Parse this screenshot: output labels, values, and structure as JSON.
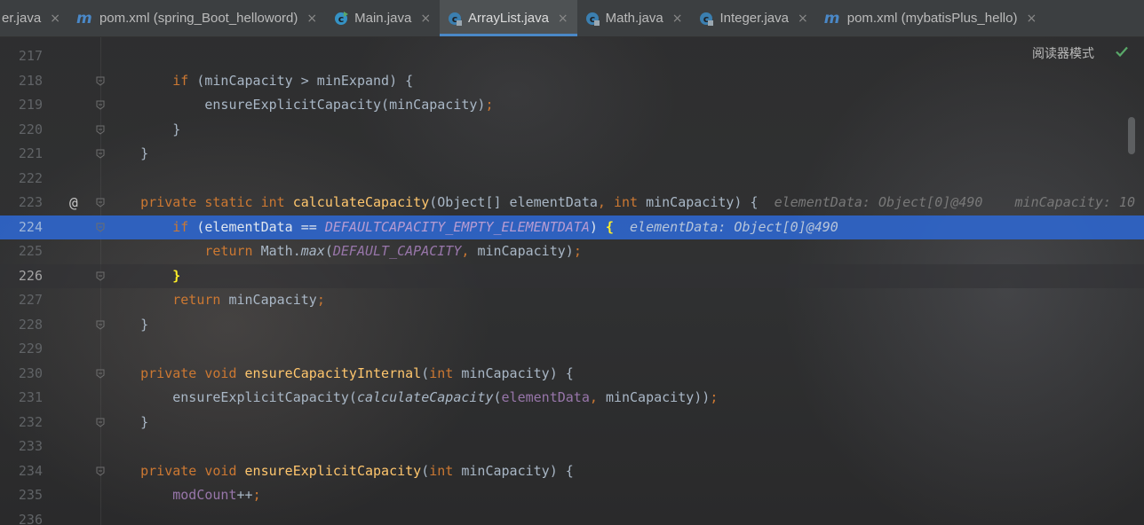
{
  "tabs": [
    {
      "label": "er.java",
      "icon": "java-class-icon",
      "active": false,
      "kind": "plain"
    },
    {
      "label": "pom.xml (spring_Boot_helloword)",
      "icon": "maven-icon",
      "active": false,
      "kind": "maven"
    },
    {
      "label": "Main.java",
      "icon": "java-class-icon",
      "active": false,
      "kind": "class-run"
    },
    {
      "label": "ArrayList.java",
      "icon": "java-class-icon",
      "active": true,
      "kind": "class-lib"
    },
    {
      "label": "Math.java",
      "icon": "java-class-icon",
      "active": false,
      "kind": "class-lib"
    },
    {
      "label": "Integer.java",
      "icon": "java-class-icon",
      "active": false,
      "kind": "class-lib"
    },
    {
      "label": "pom.xml (mybatisPlus_hello)",
      "icon": "maven-icon",
      "active": false,
      "kind": "maven"
    }
  ],
  "close_glyph": "×",
  "reader_mode": "阅读器模式",
  "colors": {
    "keyword": "#cc7832",
    "method": "#ffc66d",
    "field": "#9876aa",
    "text": "#a9b7c6",
    "highlight": "#2f65ca",
    "accent": "#4a88c7"
  },
  "lines": [
    {
      "num": "217",
      "indent": "",
      "tokens": []
    },
    {
      "num": "218",
      "indent": "        ",
      "tokens": [
        {
          "t": "if",
          "c": "kw"
        },
        {
          "t": " (minCapacity > minExpand) {",
          "c": ""
        }
      ]
    },
    {
      "num": "219",
      "indent": "            ",
      "tokens": [
        {
          "t": "ensureExplicitCapacity(minCapacity)",
          "c": ""
        },
        {
          "t": ";",
          "c": "kw"
        }
      ]
    },
    {
      "num": "220",
      "indent": "        ",
      "tokens": [
        {
          "t": "}",
          "c": ""
        }
      ]
    },
    {
      "num": "221",
      "indent": "    ",
      "tokens": [
        {
          "t": "}",
          "c": ""
        }
      ]
    },
    {
      "num": "222",
      "indent": "",
      "tokens": []
    },
    {
      "num": "223",
      "indent": "    ",
      "at": "@",
      "tokens": [
        {
          "t": "private static int ",
          "c": "kw"
        },
        {
          "t": "calculateCapacity",
          "c": "fn"
        },
        {
          "t": "(Object[] elementData",
          "c": ""
        },
        {
          "t": ", ",
          "c": "kw"
        },
        {
          "t": "int ",
          "c": "kw"
        },
        {
          "t": "minCapacity) {",
          "c": ""
        },
        {
          "t": "  elementData: Object[0]@490    minCapacity: 10",
          "c": "hint"
        }
      ]
    },
    {
      "num": "224",
      "indent": "        ",
      "highlight": true,
      "tokens": [
        {
          "t": "if",
          "c": "kw"
        },
        {
          "t": " (elementData == ",
          "c": ""
        },
        {
          "t": "DEFAULTCAPACITY_EMPTY_ELEMENTDATA",
          "c": "field ital"
        },
        {
          "t": ") ",
          "c": ""
        },
        {
          "t": "{",
          "c": "brace-match"
        },
        {
          "t": "  elementData: Object[0]@490",
          "c": "hint"
        }
      ]
    },
    {
      "num": "225",
      "indent": "            ",
      "tokens": [
        {
          "t": "return ",
          "c": "kw"
        },
        {
          "t": "Math.",
          "c": ""
        },
        {
          "t": "max",
          "c": "ital"
        },
        {
          "t": "(",
          "c": ""
        },
        {
          "t": "DEFAULT_CAPACITY",
          "c": "field ital"
        },
        {
          "t": ", ",
          "c": "kw"
        },
        {
          "t": "minCapacity)",
          "c": ""
        },
        {
          "t": ";",
          "c": "kw"
        }
      ]
    },
    {
      "num": "226",
      "indent": "        ",
      "caret": true,
      "tokens": [
        {
          "t": "}",
          "c": "brace-match"
        }
      ]
    },
    {
      "num": "227",
      "indent": "        ",
      "tokens": [
        {
          "t": "return ",
          "c": "kw"
        },
        {
          "t": "minCapacity",
          "c": ""
        },
        {
          "t": ";",
          "c": "kw"
        }
      ]
    },
    {
      "num": "228",
      "indent": "    ",
      "tokens": [
        {
          "t": "}",
          "c": ""
        }
      ]
    },
    {
      "num": "229",
      "indent": "",
      "tokens": []
    },
    {
      "num": "230",
      "indent": "    ",
      "tokens": [
        {
          "t": "private void ",
          "c": "kw"
        },
        {
          "t": "ensureCapacityInternal",
          "c": "fn"
        },
        {
          "t": "(",
          "c": ""
        },
        {
          "t": "int ",
          "c": "kw"
        },
        {
          "t": "minCapacity) {",
          "c": ""
        }
      ]
    },
    {
      "num": "231",
      "indent": "        ",
      "tokens": [
        {
          "t": "ensureExplicitCapacity(",
          "c": ""
        },
        {
          "t": "calculateCapacity",
          "c": "ital"
        },
        {
          "t": "(",
          "c": ""
        },
        {
          "t": "elementData",
          "c": "field"
        },
        {
          "t": ", ",
          "c": "kw"
        },
        {
          "t": "minCapacity))",
          "c": ""
        },
        {
          "t": ";",
          "c": "kw"
        }
      ]
    },
    {
      "num": "232",
      "indent": "    ",
      "tokens": [
        {
          "t": "}",
          "c": ""
        }
      ]
    },
    {
      "num": "233",
      "indent": "",
      "tokens": []
    },
    {
      "num": "234",
      "indent": "    ",
      "tokens": [
        {
          "t": "private void ",
          "c": "kw"
        },
        {
          "t": "ensureExplicitCapacity",
          "c": "fn"
        },
        {
          "t": "(",
          "c": ""
        },
        {
          "t": "int ",
          "c": "kw"
        },
        {
          "t": "minCapacity) {",
          "c": ""
        }
      ]
    },
    {
      "num": "235",
      "indent": "        ",
      "tokens": [
        {
          "t": "modCount",
          "c": "field"
        },
        {
          "t": "++",
          "c": ""
        },
        {
          "t": ";",
          "c": "kw"
        }
      ]
    },
    {
      "num": "236",
      "indent": "",
      "tokens": []
    }
  ]
}
